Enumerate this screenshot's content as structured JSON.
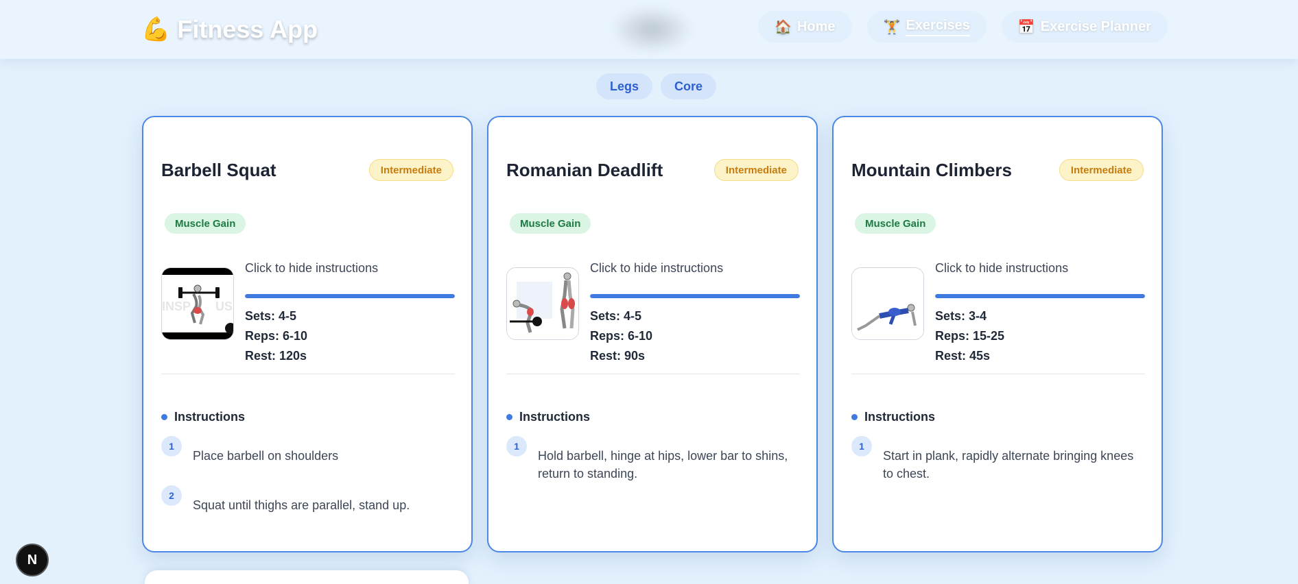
{
  "app": {
    "title": "Fitness App",
    "icon": "flexed-biceps-icon"
  },
  "nav": [
    {
      "label": "Home",
      "icon": "house-icon"
    },
    {
      "label": "Exercises",
      "icon": "weightlifter-icon"
    },
    {
      "label": "Exercise Planner",
      "icon": "calendar-icon"
    }
  ],
  "filters": [
    "Legs",
    "Core"
  ],
  "cards": [
    {
      "title": "Barbell Squat",
      "level": "Intermediate",
      "goal": "Muscle Gain",
      "toggle": "Click to hide instructions",
      "progress": 1.0,
      "sets": "Sets: 4-5",
      "reps": "Reps: 6-10",
      "rest": "Rest: 120s",
      "instructions_label": "Instructions",
      "steps": [
        {
          "num": "1",
          "text": "Place barbell on shoulders"
        },
        {
          "num": "2",
          "text": "Squat until thighs are parallel, stand up."
        }
      ]
    },
    {
      "title": "Romanian Deadlift",
      "level": "Intermediate",
      "goal": "Muscle Gain",
      "toggle": "Click to hide instructions",
      "progress": 1.0,
      "sets": "Sets: 4-5",
      "reps": "Reps: 6-10",
      "rest": "Rest: 90s",
      "instructions_label": "Instructions",
      "steps": [
        {
          "num": "1",
          "text": "Hold barbell, hinge at hips, lower bar to shins, return to standing."
        }
      ]
    },
    {
      "title": "Mountain Climbers",
      "level": "Intermediate",
      "goal": "Muscle Gain",
      "toggle": "Click to hide instructions",
      "progress": 1.0,
      "sets": "Sets: 3-4",
      "reps": "Reps: 15-25",
      "rest": "Rest: 45s",
      "instructions_label": "Instructions",
      "steps": [
        {
          "num": "1",
          "text": "Start in plank, rapidly alternate bringing knees to chest."
        }
      ]
    }
  ],
  "dev_badge": "N",
  "colors": {
    "accent": "#3f7ae0",
    "card_border": "#4b87e6",
    "badge_bg": "#fdf3c9",
    "goal_bg": "#daf5e4"
  }
}
